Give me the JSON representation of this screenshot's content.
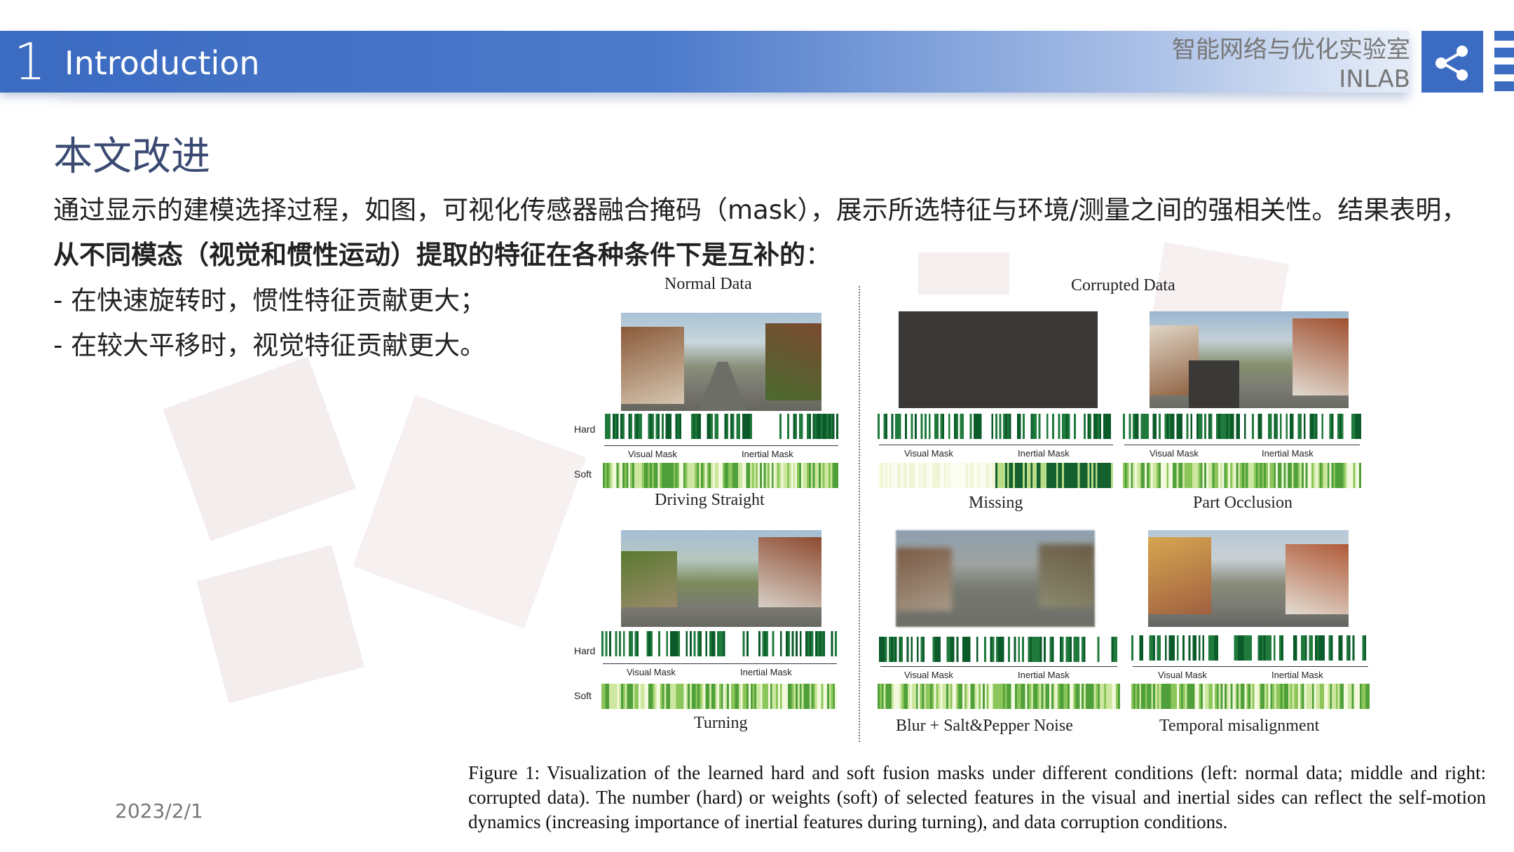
{
  "header": {
    "section_number": "1",
    "section_title": "Introduction",
    "lab_name_cn": "智能网络与优化实验室",
    "lab_name_en": "INLAB",
    "share_icon": "share-icon"
  },
  "slide": {
    "heading": "本文改进",
    "paragraph_line1": "通过显示的建模选择过程，如图，可视化传感器融合掩码（mask），展示所选特征与环境/测量之间的强相关性。结果表明，",
    "paragraph_line2_bold": "从不同模态（视觉和惯性运动）提取的特征在各种条件下是互补的",
    "paragraph_line2_tail": "：",
    "bullets": [
      "- 在快速旋转时，惯性特征贡献更大；",
      "- 在较大平移时，视觉特征贡献更大。"
    ],
    "date": "2023/2/1"
  },
  "figure": {
    "normal_title": "Normal Data",
    "corrupted_title": "Corrupted Data",
    "row_hard": "Hard",
    "row_soft": "Soft",
    "visual_mask": "Visual Mask",
    "inertial_mask": "Inertial Mask",
    "panels": {
      "driving_straight": "Driving Straight",
      "missing": "Missing",
      "part_occlusion": "Part Occlusion",
      "turning": "Turning",
      "blur_noise": "Blur + Salt&Pepper Noise",
      "temporal_misalignment": "Temporal misalignment"
    },
    "caption": "Figure 1: Visualization of the learned hard and soft fusion masks under different conditions (left: normal data; middle and right: corrupted data). The number (hard) or weights (soft) of selected features in the visual and inertial sides can reflect the self-motion dynamics (increasing importance of inertial features during turning), and data corruption conditions."
  },
  "colors": {
    "accent_blue": "#3c6cc2",
    "hard_mask_green": "#0b5a2a",
    "soft_mask_green": "#8cc65a"
  }
}
